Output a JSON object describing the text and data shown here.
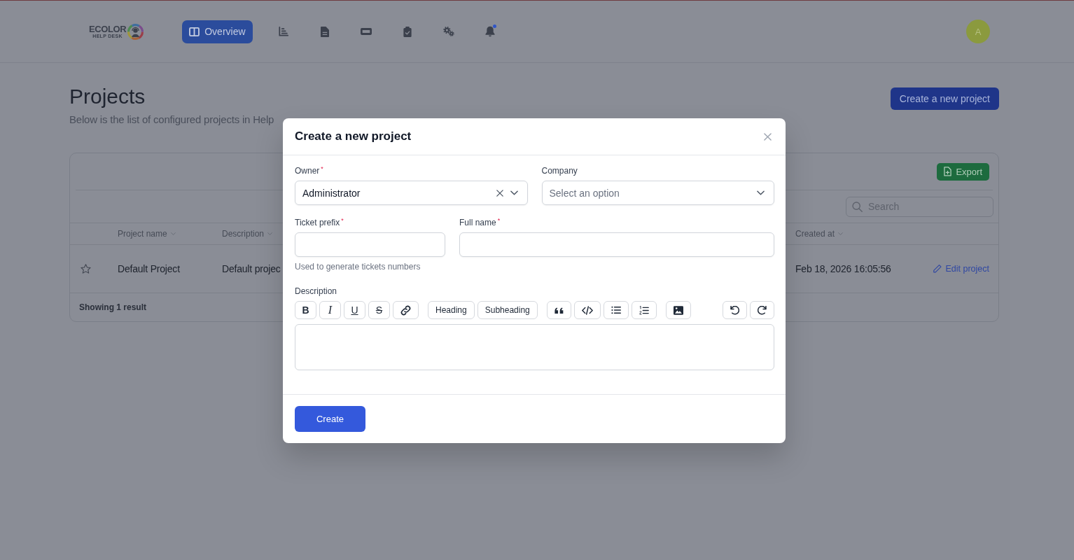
{
  "header": {
    "logo": {
      "wordmark": "ECOLOR",
      "tagline": "HELP DESK"
    },
    "nav": [
      {
        "kind": "overview",
        "label": "Overview",
        "selected": true,
        "alert": false
      },
      {
        "kind": "chart",
        "selected": false,
        "alert": false
      },
      {
        "kind": "document",
        "selected": false,
        "alert": false
      },
      {
        "kind": "ticket",
        "selected": false,
        "alert": false
      },
      {
        "kind": "clipboard",
        "selected": false,
        "alert": false
      },
      {
        "kind": "gears",
        "selected": false,
        "alert": false
      },
      {
        "kind": "bell",
        "selected": false,
        "alert": true
      }
    ],
    "avatar": {
      "initial": "A"
    }
  },
  "page": {
    "title": "Projects",
    "subtitle": "Below is the list of configured projects in Help",
    "create_button": "Create a new project"
  },
  "table": {
    "export_button": "Export",
    "search": {
      "placeholder": "Search"
    },
    "columns": [
      {
        "label": "Project name",
        "sortable": true
      },
      {
        "label": "Description",
        "sortable": true
      },
      {
        "label": "Created at",
        "sortable": true
      }
    ],
    "rows": [
      {
        "starred": false,
        "project_name": "Default Project",
        "description": "Default projec",
        "created_at": "Feb 18, 2026 16:05:56",
        "action": "Edit project"
      }
    ],
    "footer": "Showing 1 result"
  },
  "modal": {
    "title": "Create a new project",
    "rows": [
      [
        {
          "kind": "select",
          "label": "Owner$^{*}$",
          "value": "Administrator",
          "clearable": true
        },
        {
          "kind": "select",
          "label": "Company",
          "placeholder": "Select an option",
          "clearable": false
        }
      ],
      [
        {
          "kind": "text",
          "label": "Ticket prefix$^{*}$",
          "hint": "Used to generate tickets numbers"
        },
        {
          "kind": "text",
          "label": "Full name$^{*}$"
        }
      ]
    ],
    "editor": {
      "label": "Description",
      "toolbar": [
        [
          {
            "kind": "bold",
            "label": "B"
          },
          {
            "kind": "italic",
            "label": "I"
          },
          {
            "kind": "underline",
            "label": "U"
          },
          {
            "kind": "strike",
            "label": "S"
          },
          {
            "kind": "link"
          }
        ],
        [
          {
            "kind": "heading",
            "label": "Heading"
          },
          {
            "kind": "subheading",
            "label": "Subheading"
          }
        ],
        [
          {
            "kind": "quote"
          },
          {
            "kind": "code"
          },
          {
            "kind": "bullet-list"
          },
          {
            "kind": "ordered-list"
          }
        ],
        [
          {
            "kind": "image"
          }
        ],
        [
          {
            "kind": "undo"
          },
          {
            "kind": "redo"
          }
        ]
      ]
    },
    "submit": "Create"
  }
}
